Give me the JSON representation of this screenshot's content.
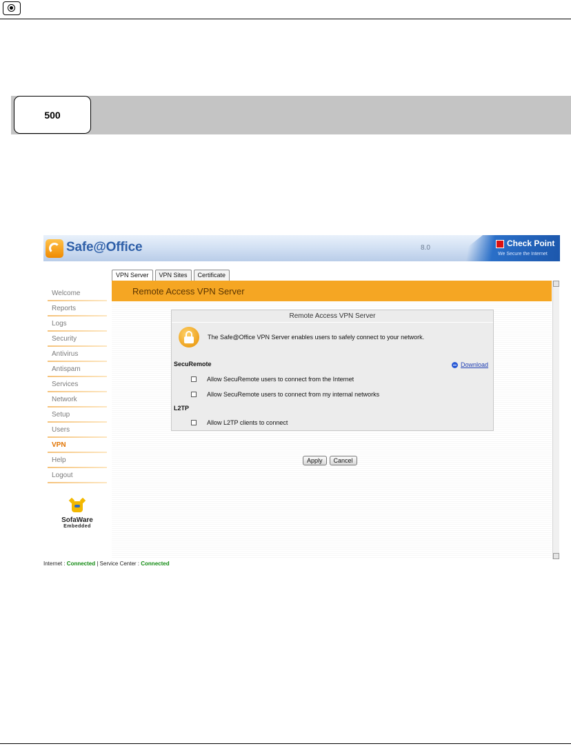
{
  "document": {
    "model_label": "500"
  },
  "app": {
    "logo_text": "Safe@Office",
    "version": "8.0",
    "brand_name": "Check Point",
    "brand_tagline": "We Secure the Internet",
    "tabs": [
      {
        "label": "VPN Server",
        "active": true
      },
      {
        "label": "VPN Sites",
        "active": false
      },
      {
        "label": "Certificate",
        "active": false
      }
    ],
    "banner_title": "Remote Access VPN Server",
    "sidebar": [
      {
        "label": "Welcome",
        "active": false
      },
      {
        "label": "Reports",
        "active": false
      },
      {
        "label": "Logs",
        "active": false
      },
      {
        "label": "Security",
        "active": false
      },
      {
        "label": "Antivirus",
        "active": false
      },
      {
        "label": "Antispam",
        "active": false
      },
      {
        "label": "Services",
        "active": false
      },
      {
        "label": "Network",
        "active": false
      },
      {
        "label": "Setup",
        "active": false
      },
      {
        "label": "Users",
        "active": false
      },
      {
        "label": "VPN",
        "active": true
      },
      {
        "label": "Help",
        "active": false
      },
      {
        "label": "Logout",
        "active": false
      }
    ],
    "vendor_logo": {
      "name": "SofaWare",
      "sub": "Embedded"
    },
    "panel": {
      "title": "Remote Access VPN Server",
      "description": "The Safe@Office VPN Server enables users to safely connect to your network.",
      "securemote_heading": "SecuRemote",
      "download_label": "Download",
      "securemote_options": [
        {
          "label": "Allow SecuRemote users to connect from the Internet",
          "checked": false
        },
        {
          "label": "Allow SecuRemote users to connect from my internal networks",
          "checked": false
        }
      ],
      "l2tp_heading": "L2TP",
      "l2tp_options": [
        {
          "label": "Allow L2TP clients to connect",
          "checked": false
        }
      ]
    },
    "buttons": {
      "apply": "Apply",
      "cancel": "Cancel"
    },
    "status": {
      "internet_label": "Internet : ",
      "internet_value": "Connected",
      "separator": " | ",
      "service_label": "Service Center : ",
      "service_value": "Connected"
    },
    "colors": {
      "accent": "#f5a623",
      "active_nav": "#e27300",
      "link": "#1f3fb3",
      "connected": "#118a11"
    }
  }
}
